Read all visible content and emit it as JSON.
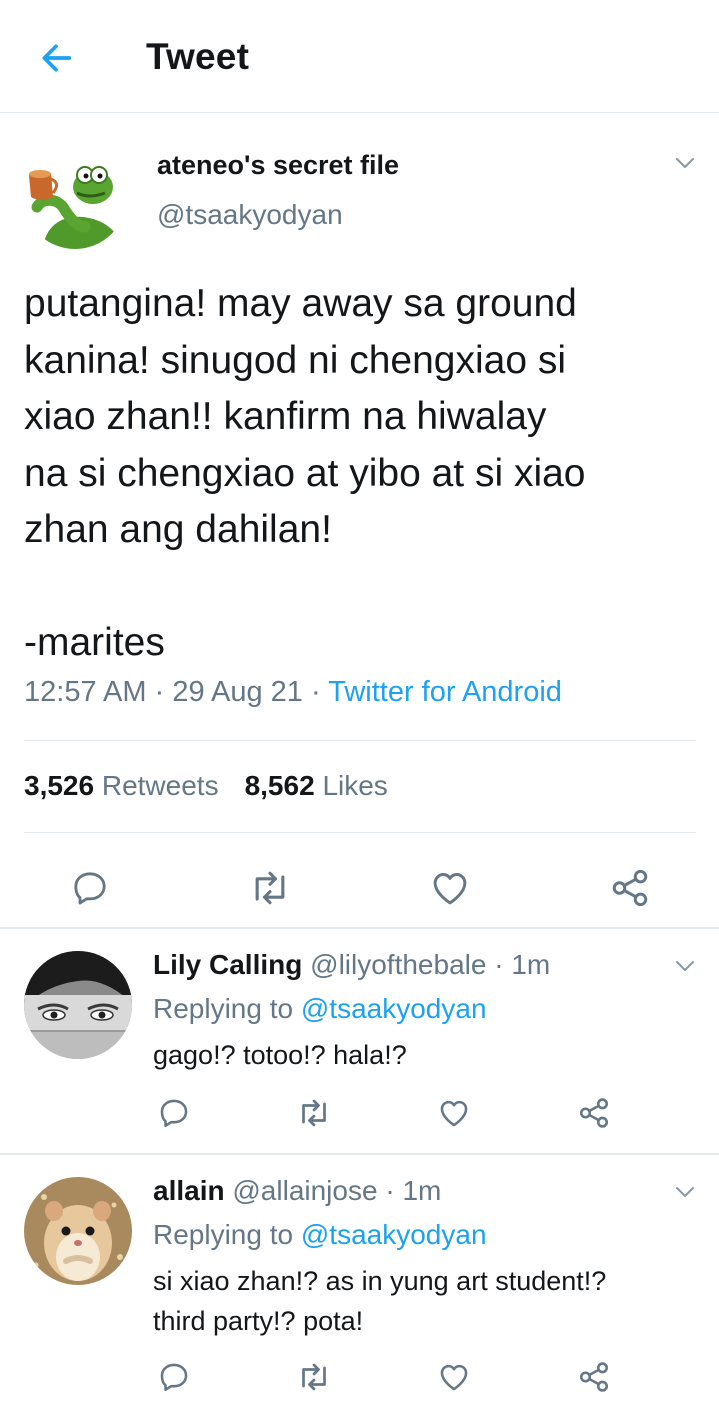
{
  "header": {
    "title": "Tweet"
  },
  "main_tweet": {
    "name": "ateneo's secret file",
    "handle": "@tsaakyodyan",
    "text": "putangina! may away sa ground\nkanina! sinugod ni chengxiao si\nxiao zhan!! kanfirm na hiwalay\nna si chengxiao at yibo at si xiao\nzhan ang dahilan!\n\n-marites",
    "time": "12:57 AM",
    "date": "29 Aug 21",
    "separator": " · ",
    "source": "Twitter for Android",
    "retweets_count": "3,526",
    "retweets_label": "Retweets",
    "likes_count": "8,562",
    "likes_label": "Likes"
  },
  "replies": [
    {
      "name": "Lily Calling",
      "handle": "@lilyofthebale",
      "time": "1m",
      "replying_label": "Replying to",
      "replying_handle": "@tsaakyodyan",
      "text": "gago!? totoo!? hala!?"
    },
    {
      "name": "allain",
      "handle": "@allainjose",
      "time": "1m",
      "replying_label": "Replying to",
      "replying_handle": "@tsaakyodyan",
      "text": "si xiao zhan!? as in yung art student!?\nthird party!? pota!"
    }
  ],
  "icons": {
    "back": "arrow-left-icon",
    "caret": "chevron-down-icon",
    "reply": "comment-icon",
    "retweet": "retweet-icon",
    "like": "heart-icon",
    "share": "share-icon"
  },
  "colors": {
    "accent": "#1da1f2",
    "text": "#14171a",
    "muted": "#657786",
    "divider": "#e1e8ed"
  }
}
